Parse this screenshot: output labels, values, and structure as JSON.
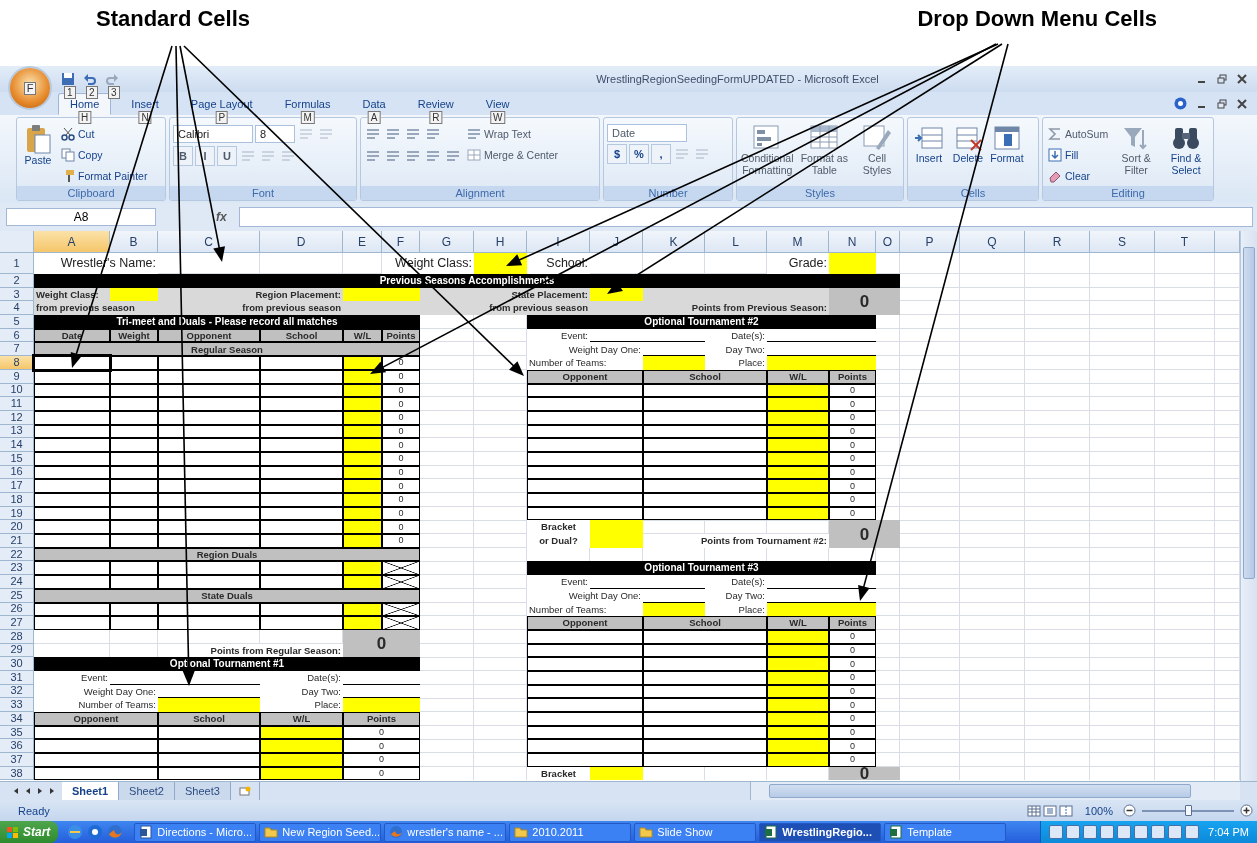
{
  "annotations": [
    {
      "label": "Standard Cells"
    },
    {
      "label": "Drop Down Menu Cells"
    }
  ],
  "window": {
    "title": "WrestlingRegionSeedingFormUPDATED - Microsoft Excel",
    "office_keytip": "F",
    "quick_access_keytips": [
      "1",
      "2",
      "3"
    ]
  },
  "ribbon": {
    "tabs": [
      {
        "label": "Home",
        "keytip": "H",
        "selected": true
      },
      {
        "label": "Insert",
        "keytip": "N",
        "selected": false
      },
      {
        "label": "Page Layout",
        "keytip": "P",
        "selected": false
      },
      {
        "label": "Formulas",
        "keytip": "M",
        "selected": false
      },
      {
        "label": "Data",
        "keytip": "A",
        "selected": false
      },
      {
        "label": "Review",
        "keytip": "R",
        "selected": false
      },
      {
        "label": "View",
        "keytip": "W",
        "selected": false
      }
    ],
    "groups": [
      {
        "label": "Clipboard",
        "columns": [
          [
            [
              {
                "kind": "large",
                "label": "Paste",
                "disabled": false
              }
            ]
          ],
          [
            [
              {
                "kind": "small",
                "label": "Cut",
                "disabled": false
              }
            ],
            [
              {
                "kind": "small",
                "label": "Copy",
                "disabled": false
              }
            ],
            [
              {
                "kind": "small",
                "label": "Format Painter",
                "disabled": false
              }
            ]
          ]
        ]
      },
      {
        "label": "Font",
        "columns": [
          [
            [
              {
                "kind": "combo",
                "value": "Calibri",
                "disabled": false
              },
              {
                "kind": "combo",
                "value": "8",
                "disabled": false
              },
              {
                "kind": "tool",
                "disabled": true
              },
              {
                "kind": "tool",
                "disabled": true
              }
            ],
            [
              {
                "kind": "glyph",
                "label": "B",
                "disabled": true
              },
              {
                "kind": "glyph",
                "label": "I",
                "disabled": true
              },
              {
                "kind": "glyph",
                "label": "U",
                "disabled": true
              },
              {
                "kind": "tool",
                "disabled": true
              },
              {
                "kind": "tool",
                "disabled": true
              },
              {
                "kind": "tool",
                "disabled": true
              }
            ]
          ]
        ]
      },
      {
        "label": "Alignment",
        "columns": [
          [
            [
              {
                "kind": "tool",
                "disabled": false
              },
              {
                "kind": "tool",
                "disabled": false
              },
              {
                "kind": "tool",
                "disabled": false
              },
              {
                "kind": "tool",
                "disabled": false
              }
            ],
            [
              {
                "kind": "tool",
                "disabled": false
              },
              {
                "kind": "tool",
                "disabled": false
              },
              {
                "kind": "tool",
                "disabled": false
              },
              {
                "kind": "tool",
                "disabled": false
              },
              {
                "kind": "tool",
                "disabled": false
              }
            ]
          ],
          [
            [
              {
                "kind": "small",
                "label": "Wrap Text",
                "disabled": true
              }
            ],
            [
              {
                "kind": "small",
                "label": "Merge & Center",
                "disabled": true
              }
            ]
          ]
        ]
      },
      {
        "label": "Number",
        "columns": [
          [
            [
              {
                "kind": "combo",
                "value": "Date",
                "disabled": true
              }
            ],
            [
              {
                "kind": "glyph",
                "label": "$",
                "disabled": false
              },
              {
                "kind": "glyph",
                "label": "%",
                "disabled": false
              },
              {
                "kind": "glyph",
                "label": ",",
                "disabled": false
              },
              {
                "kind": "tool",
                "disabled": true
              },
              {
                "kind": "tool",
                "disabled": true
              }
            ]
          ]
        ]
      },
      {
        "label": "Styles",
        "columns": [
          [
            [
              {
                "kind": "large",
                "label": "Conditional Formatting",
                "disabled": true
              }
            ]
          ],
          [
            [
              {
                "kind": "large",
                "label": "Format as Table",
                "disabled": true
              }
            ]
          ],
          [
            [
              {
                "kind": "large",
                "label": "Cell Styles",
                "disabled": true
              }
            ]
          ]
        ]
      },
      {
        "label": "Cells",
        "columns": [
          [
            [
              {
                "kind": "large",
                "label": "Insert",
                "disabled": false
              }
            ]
          ],
          [
            [
              {
                "kind": "large",
                "label": "Delete",
                "disabled": false
              }
            ]
          ],
          [
            [
              {
                "kind": "large",
                "label": "Format",
                "disabled": false
              }
            ]
          ]
        ]
      },
      {
        "label": "Editing",
        "columns": [
          [
            [
              {
                "kind": "small",
                "label": "AutoSum",
                "disabled": true
              }
            ],
            [
              {
                "kind": "small",
                "label": "Fill",
                "disabled": false
              }
            ],
            [
              {
                "kind": "small",
                "label": "Clear",
                "disabled": false
              }
            ]
          ],
          [
            [
              {
                "kind": "large",
                "label": "Sort & Filter",
                "disabled": true
              }
            ]
          ],
          [
            [
              {
                "kind": "large",
                "label": "Find & Select",
                "disabled": false
              }
            ]
          ]
        ]
      }
    ]
  },
  "formula_bar": {
    "name_box": "A8",
    "function_label": "fx"
  },
  "sheet": {
    "columns": [
      "A",
      "B",
      "C",
      "D",
      "E",
      "F",
      "G",
      "H",
      "I",
      "J",
      "K",
      "L",
      "M",
      "N",
      "O",
      "P",
      "Q",
      "R",
      "S",
      "T"
    ],
    "rows": [
      "1",
      "2",
      "3",
      "4",
      "5",
      "6",
      "7",
      "8",
      "9",
      "10",
      "11",
      "12",
      "13",
      "14",
      "15",
      "16",
      "17",
      "18",
      "19",
      "20",
      "21",
      "22",
      "23",
      "24",
      "25",
      "26",
      "27",
      "28",
      "29",
      "30",
      "31",
      "32",
      "33",
      "34",
      "35",
      "36",
      "37",
      "38"
    ],
    "cells": [
      {
        "kind": "title-label",
        "text": "Wrestler's Name:"
      },
      {
        "kind": "title-label",
        "text": "Weight Class:"
      },
      {
        "kind": "yellow"
      },
      {
        "kind": "title-label",
        "text": "School:"
      },
      {
        "kind": "title-label",
        "text": "Grade:"
      },
      {
        "kind": "yellow"
      },
      {
        "kind": "banner",
        "text": "Previous Seasons Accomplishments"
      },
      {
        "kind": "shade"
      },
      {
        "kind": "bold-label",
        "text": "Weight Class:"
      },
      {
        "kind": "yellow"
      },
      {
        "kind": "bold-label-right",
        "text": "Region Placement:"
      },
      {
        "kind": "yellow"
      },
      {
        "kind": "bold-label-right",
        "text": "State Placement:"
      },
      {
        "kind": "yellow"
      },
      {
        "kind": "total",
        "text": "0"
      },
      {
        "kind": "bold-label",
        "text": "from previous season"
      },
      {
        "kind": "bold-label-right",
        "text": "from previous season"
      },
      {
        "kind": "bold-label-right",
        "text": "from previous season"
      },
      {
        "kind": "bold-label-right",
        "text": "Points from Previous Season:"
      },
      {
        "kind": "banner",
        "text": "Tri-meet and Duals - Please record all matches"
      },
      {
        "kind": "banner",
        "text": "Optional Tournament #2"
      },
      {
        "kind": "column-head",
        "text": "Date"
      },
      {
        "kind": "column-head",
        "text": "Weight"
      },
      {
        "kind": "column-head",
        "text": "Opponent"
      },
      {
        "kind": "column-head",
        "text": "School"
      },
      {
        "kind": "column-head",
        "text": "W/L"
      },
      {
        "kind": "column-head",
        "text": "Points"
      },
      {
        "kind": "label-right",
        "text": "Event:"
      },
      {
        "kind": "underline"
      },
      {
        "kind": "label-right",
        "text": "Date(s):"
      },
      {
        "kind": "underline"
      },
      {
        "kind": "band",
        "text": "Regular Season"
      },
      {
        "kind": "label-right",
        "text": "Weight Day One:"
      },
      {
        "kind": "underline"
      },
      {
        "kind": "label-right",
        "text": "Day Two:"
      },
      {
        "kind": "underline"
      },
      {
        "kind": "entry"
      },
      {
        "kind": "entry"
      },
      {
        "kind": "entry"
      },
      {
        "kind": "entry"
      },
      {
        "kind": "dropdown"
      },
      {
        "kind": "points",
        "values": [
          "0",
          "0",
          "0",
          "0",
          "0",
          "0",
          "0",
          "0",
          "0",
          "0",
          "0",
          "0",
          "0",
          "0"
        ]
      },
      {
        "kind": "label",
        "text": "Number of Teams:"
      },
      {
        "kind": "yellow"
      },
      {
        "kind": "label-right",
        "text": "Place:"
      },
      {
        "kind": "yellow"
      },
      {
        "kind": "column-head",
        "text": "Opponent"
      },
      {
        "kind": "column-head",
        "text": "School"
      },
      {
        "kind": "column-head",
        "text": "W/L"
      },
      {
        "kind": "column-head",
        "text": "Points"
      },
      {
        "kind": "entry"
      },
      {
        "kind": "entry"
      },
      {
        "kind": "dropdown"
      },
      {
        "kind": "points",
        "values": [
          "0",
          "0",
          "0",
          "0",
          "0",
          "0",
          "0",
          "0",
          "0",
          "0"
        ]
      },
      {
        "kind": "bold-label-center",
        "text": "Bracket"
      },
      {
        "kind": "yellow"
      },
      {
        "kind": "total",
        "text": "0"
      },
      {
        "kind": "bold-label-center",
        "text": "or Dual?"
      },
      {
        "kind": "bold-label-right",
        "text": "Points from Tournament #2:"
      },
      {
        "kind": "band",
        "text": "Region Duals"
      },
      {
        "kind": "entry"
      },
      {
        "kind": "entry"
      },
      {
        "kind": "entry"
      },
      {
        "kind": "entry"
      },
      {
        "kind": "dropdown"
      },
      {
        "kind": "crossed"
      },
      {
        "kind": "banner",
        "text": "Optional Tournament #3"
      },
      {
        "kind": "label-right",
        "text": "Event:"
      },
      {
        "kind": "underline"
      },
      {
        "kind": "label-right",
        "text": "Date(s):"
      },
      {
        "kind": "underline"
      },
      {
        "kind": "band",
        "text": "State Duals"
      },
      {
        "kind": "label-right",
        "text": "Weight Day One:"
      },
      {
        "kind": "underline"
      },
      {
        "kind": "label-right",
        "text": "Day Two:"
      },
      {
        "kind": "underline"
      },
      {
        "kind": "entry"
      },
      {
        "kind": "entry"
      },
      {
        "kind": "entry"
      },
      {
        "kind": "entry"
      },
      {
        "kind": "dropdown"
      },
      {
        "kind": "crossed"
      },
      {
        "kind": "label",
        "text": "Number of Teams:"
      },
      {
        "kind": "yellow"
      },
      {
        "kind": "label-right",
        "text": "Place:"
      },
      {
        "kind": "yellow"
      },
      {
        "kind": "column-head",
        "text": "Opponent"
      },
      {
        "kind": "column-head",
        "text": "School"
      },
      {
        "kind": "column-head",
        "text": "W/L"
      },
      {
        "kind": "column-head",
        "text": "Points"
      },
      {
        "kind": "total",
        "text": "0"
      },
      {
        "kind": "entry"
      },
      {
        "kind": "entry"
      },
      {
        "kind": "dropdown"
      },
      {
        "kind": "points",
        "values": [
          "0",
          "0",
          "0",
          "0",
          "0",
          "0",
          "0",
          "0",
          "0",
          "0"
        ]
      },
      {
        "kind": "bold-label-right",
        "text": "Points from Regular Season:"
      },
      {
        "kind": "banner",
        "text": "Optional Tournament #1"
      },
      {
        "kind": "label-right",
        "text": "Event:"
      },
      {
        "kind": "underline"
      },
      {
        "kind": "label-right",
        "text": "Date(s):"
      },
      {
        "kind": "underline"
      },
      {
        "kind": "label-right",
        "text": "Weight Day One:"
      },
      {
        "kind": "underline"
      },
      {
        "kind": "label-right",
        "text": "Day Two:"
      },
      {
        "kind": "underline"
      },
      {
        "kind": "label-right",
        "text": "Number of Teams:"
      },
      {
        "kind": "yellow"
      },
      {
        "kind": "label-right",
        "text": "Place:"
      },
      {
        "kind": "yellow"
      },
      {
        "kind": "column-head",
        "text": "Opponent"
      },
      {
        "kind": "column-head",
        "text": "School"
      },
      {
        "kind": "column-head",
        "text": "W/L"
      },
      {
        "kind": "column-head",
        "text": "Points"
      },
      {
        "kind": "entry"
      },
      {
        "kind": "entry"
      },
      {
        "kind": "dropdown"
      },
      {
        "kind": "points",
        "values": [
          "0",
          "0",
          "0",
          "0"
        ]
      },
      {
        "kind": "bold-label-center",
        "text": "Bracket"
      },
      {
        "kind": "yellow"
      },
      {
        "kind": "total",
        "text": "0"
      }
    ]
  },
  "sheet_tabs": [
    {
      "label": "Sheet1",
      "selected": true
    },
    {
      "label": "Sheet2",
      "selected": false
    },
    {
      "label": "Sheet3",
      "selected": false
    }
  ],
  "status_bar": {
    "text": "Ready",
    "zoom": "100%",
    "zoom_slider": {
      "level": 0.5
    }
  },
  "taskbar": {
    "start": "Start",
    "clock": "7:04 PM",
    "items": [
      {
        "label": "Directions - Micro...",
        "selected": false
      },
      {
        "label": "New Region Seed...",
        "selected": false
      },
      {
        "label": "wrestler's name - ...",
        "selected": false
      },
      {
        "label": "2010.2011",
        "selected": false
      },
      {
        "label": "Slide Show",
        "selected": false
      },
      {
        "label": "WrestlingRegio...",
        "selected": true
      },
      {
        "label": "Template",
        "selected": false
      }
    ]
  }
}
